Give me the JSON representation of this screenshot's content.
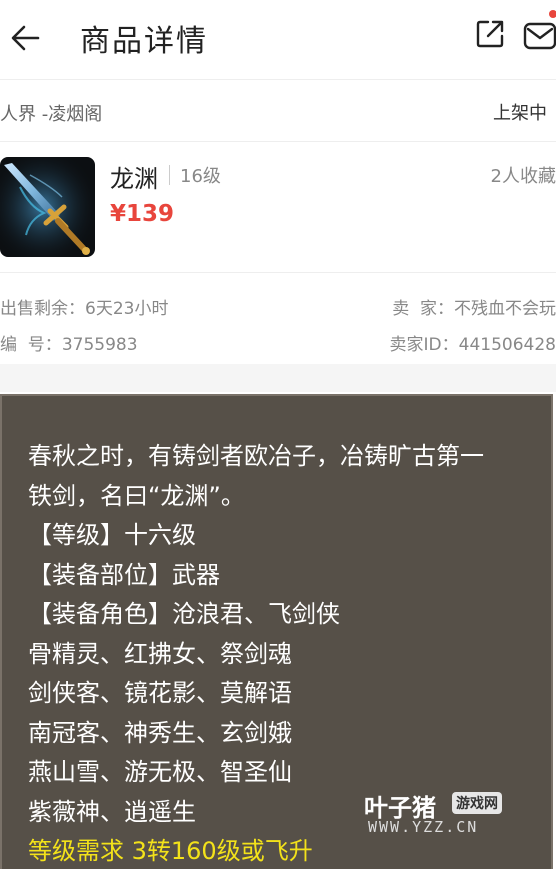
{
  "header": {
    "title": "商品详情",
    "back_icon": "arrow-left-icon",
    "share_icon": "share-icon",
    "message_icon": "mail-icon",
    "notification_dot_color": "#e8453c"
  },
  "server": {
    "name": "人界 -凌烟阁",
    "status": "上架中"
  },
  "item": {
    "name": "龙渊",
    "level": "16级",
    "price": "¥139",
    "favorites": "2人收藏",
    "image": "sword-thumbnail"
  },
  "info": {
    "remaining_label": "出售剩余：",
    "remaining_value": "6天23小时",
    "seller_label": "卖  家：",
    "seller_value": "不残血不会玩",
    "number_label": "编  号：",
    "number_value": "3755983",
    "seller_id_label": "卖家ID：",
    "seller_id_value": "441506428"
  },
  "description": {
    "lines": [
      "春秋之时，有铸剑者欧冶子，冶铸旷古第一",
      "铁剑，名曰“龙渊”。",
      "【等级】十六级",
      "【装备部位】武器",
      "【装备角色】沧浪君、飞剑侠",
      "骨精灵、红拂女、祭剑魂",
      "剑侠客、镜花影、莫解语",
      "南冠客、神秀生、玄剑娥",
      "燕山雪、游无极、智圣仙",
      "紫薇神、逍遥生"
    ],
    "requirement": "等级需求 3转160级或飞升",
    "requirement_color": "#f3e21a"
  },
  "watermark": {
    "main": "叶子猪",
    "badge": "游戏网",
    "url": "WWW.YZZ.CN"
  }
}
